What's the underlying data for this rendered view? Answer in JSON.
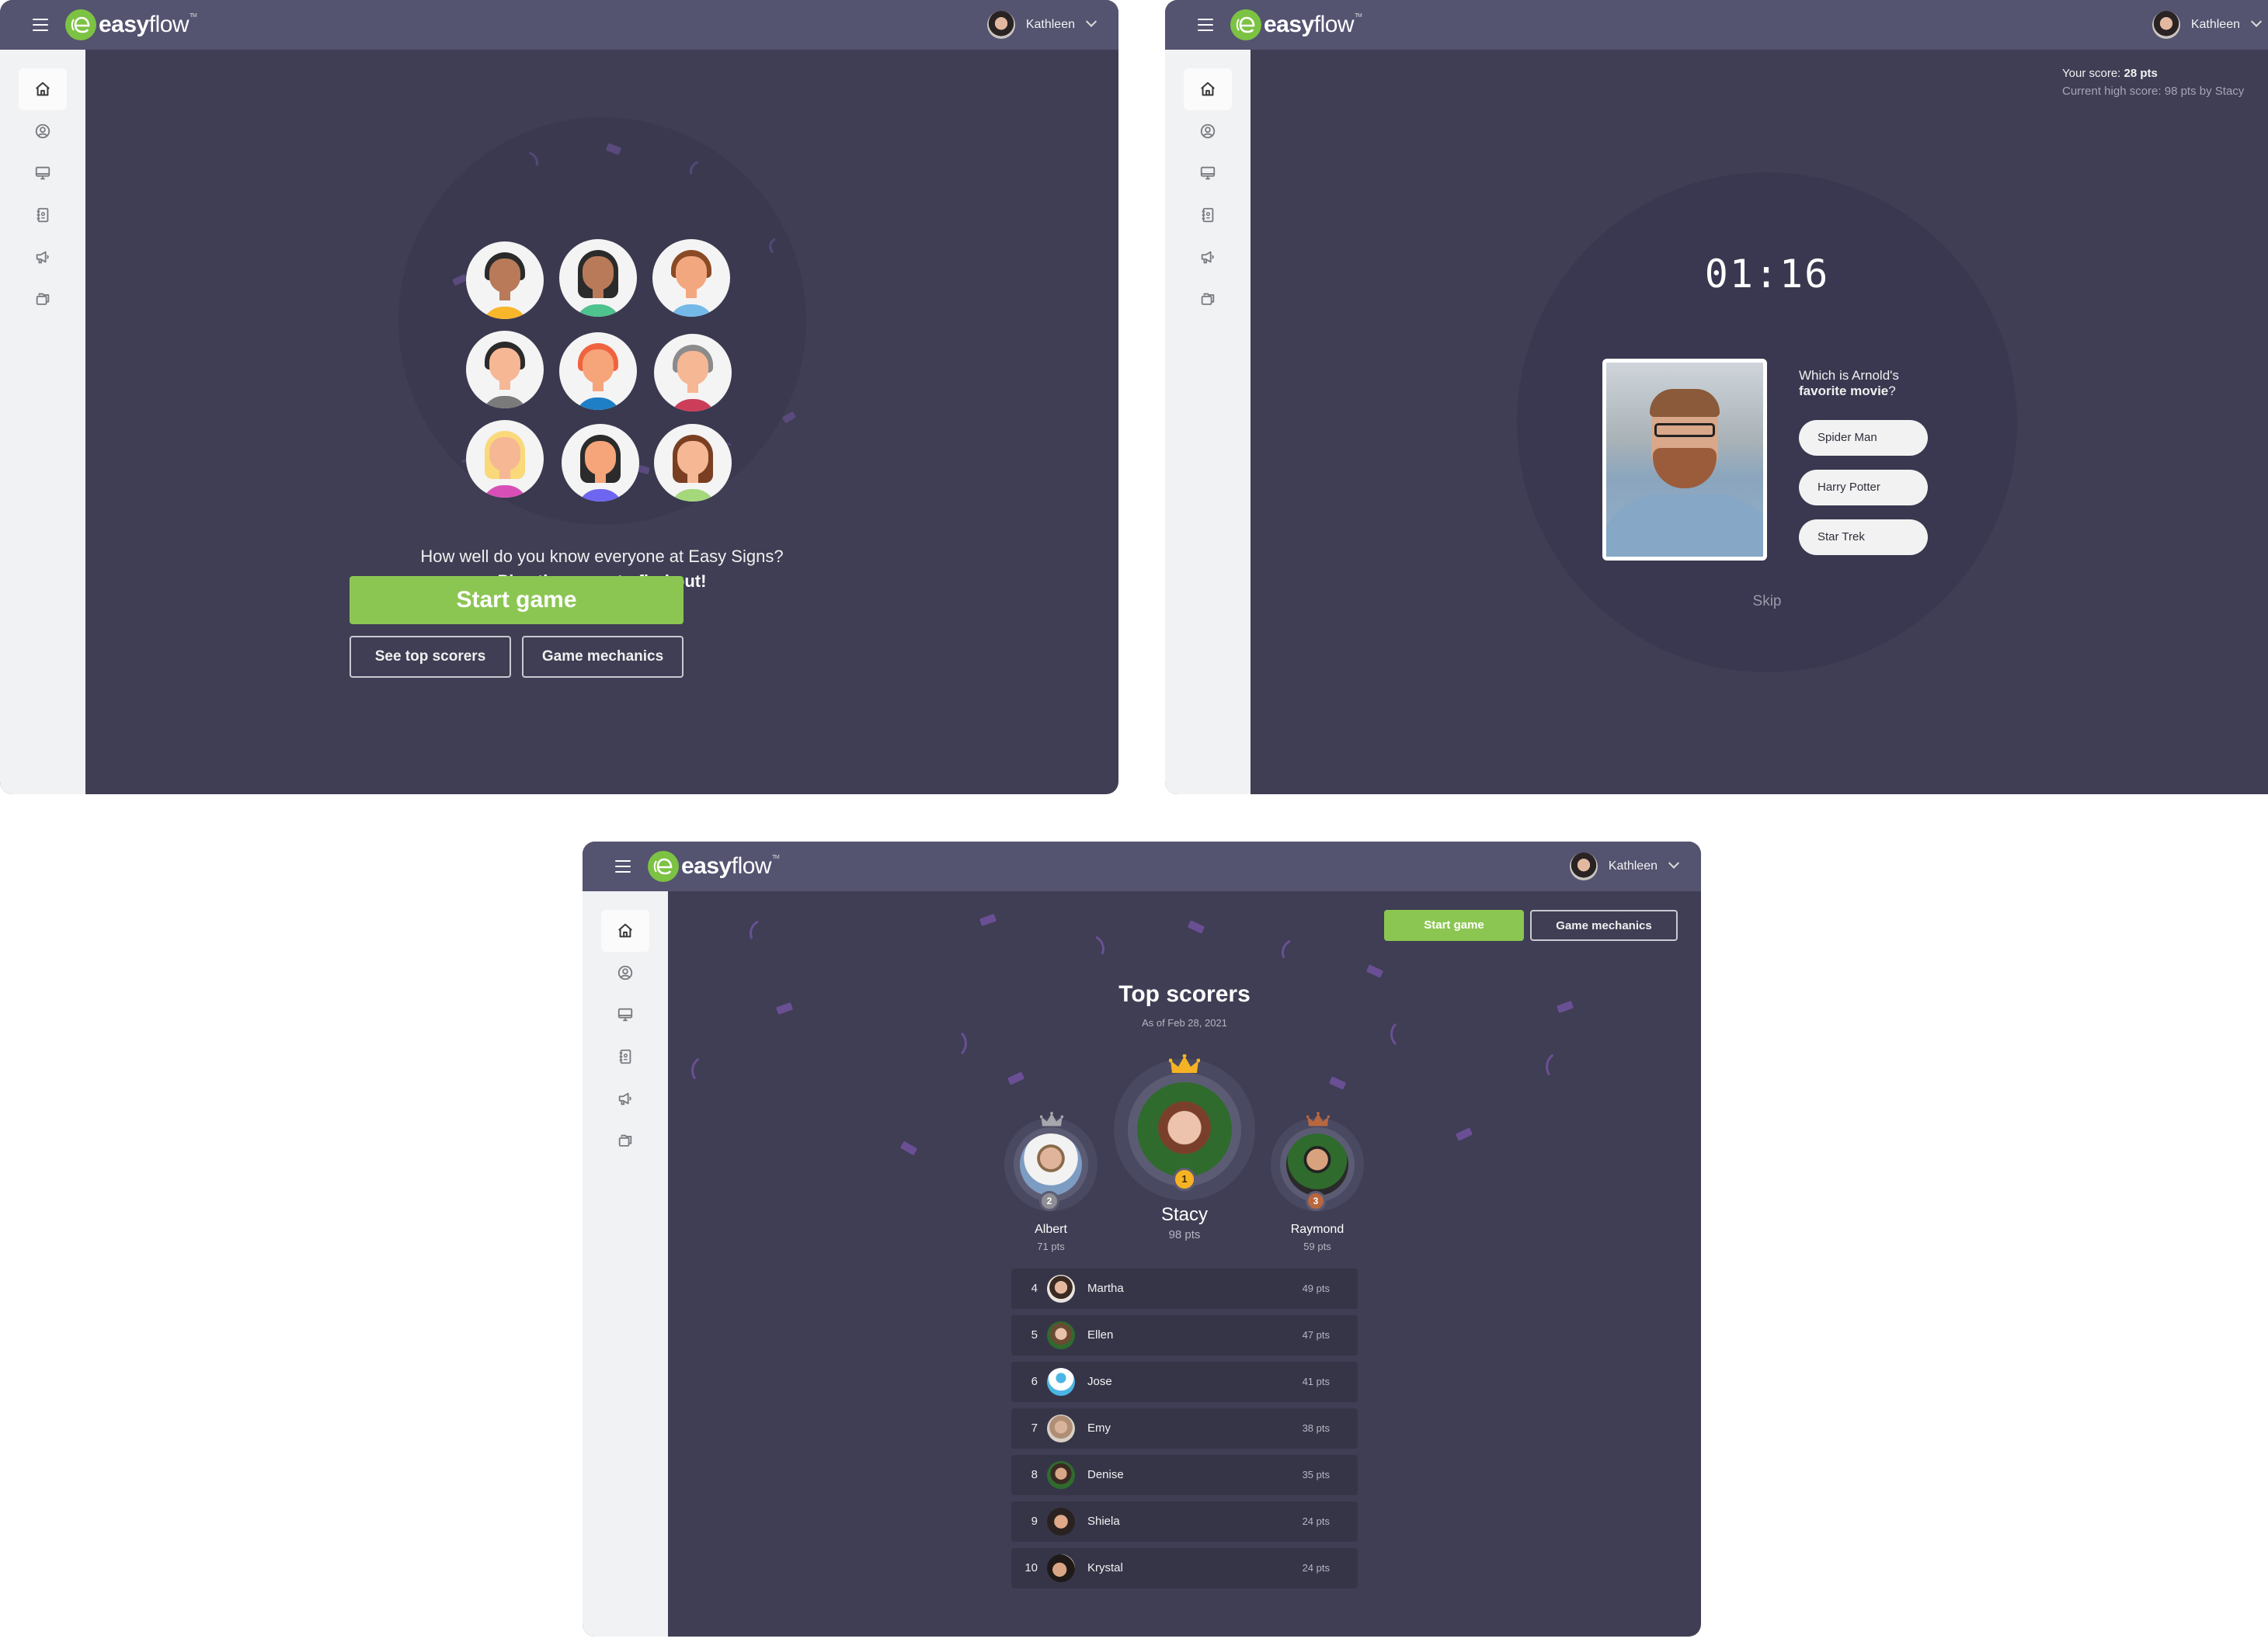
{
  "app": {
    "brand": {
      "name_bold": "easy",
      "name_light": "flow",
      "trademark": "TM"
    },
    "user": {
      "name": "Kathleen"
    },
    "sidebar": {
      "items": [
        {
          "id": "home",
          "icon": "home-icon",
          "active": true
        },
        {
          "id": "profile",
          "icon": "user-circle-icon",
          "active": false
        },
        {
          "id": "display",
          "icon": "monitor-icon",
          "active": false
        },
        {
          "id": "directory",
          "icon": "contact-book-icon",
          "active": false
        },
        {
          "id": "announcements",
          "icon": "megaphone-icon",
          "active": false
        },
        {
          "id": "files",
          "icon": "folders-icon",
          "active": false
        }
      ]
    },
    "colors": {
      "accent": "#8bc652",
      "header": "#545370",
      "background": "#3f3e54",
      "sidebar": "#f1f2f4",
      "gold": "#f5b324",
      "silver": "#9a9a9a",
      "bronze": "#b8673f"
    }
  },
  "intro_screen": {
    "line1": "How well do you know everyone at Easy Signs?",
    "line2": "Play the game to find out!",
    "start_label": "Start game",
    "scorers_label": "See top scorers",
    "mechanics_label": "Game mechanics",
    "illustration_avatars": [
      {
        "skin": "#b97a5a",
        "hair": "#2b2b2b",
        "shirt": "#f8b62a"
      },
      {
        "skin": "#b97a5a",
        "hair": "#2b2b2b",
        "shirt": "#4fc38e"
      },
      {
        "skin": "#f3a77f",
        "hair": "#8a4a25",
        "shirt": "#74b9e8"
      },
      {
        "skin": "#f6b795",
        "hair": "#2b2b2b",
        "shirt": "#7a7a7a"
      },
      {
        "skin": "#f6a47a",
        "hair": "#f0633f",
        "shirt": "#1e7fc7"
      },
      {
        "skin": "#f6b795",
        "hair": "#8b8b8b",
        "shirt": "#cc3d59"
      },
      {
        "skin": "#f6b795",
        "hair": "#f9d97a",
        "shirt": "#d74fb6"
      },
      {
        "skin": "#f6a47a",
        "hair": "#2b2b2b",
        "shirt": "#6e66f0"
      },
      {
        "skin": "#f6b795",
        "hair": "#7a3f22",
        "shirt": "#a4d87b"
      }
    ]
  },
  "game_screen": {
    "score_label": "Your score:",
    "score_value": "28 pts",
    "high_score_text": "Current high score: 98 pts by Stacy",
    "timer": "01:16",
    "question_plain": "Which is Arnold's",
    "question_bold": "favorite movie",
    "question_end": "?",
    "options": [
      "Spider Man",
      "Harry Potter",
      "Star Trek"
    ],
    "skip_label": "Skip"
  },
  "scores_screen": {
    "start_label": "Start game",
    "mechanics_label": "Game mechanics",
    "title": "Top scorers",
    "as_of": "As of Feb 28, 2021",
    "podium": [
      {
        "rank": "1",
        "name": "Stacy",
        "pts": "98 pts",
        "medal": "gold"
      },
      {
        "rank": "2",
        "name": "Albert",
        "pts": "71 pts",
        "medal": "silver"
      },
      {
        "rank": "3",
        "name": "Raymond",
        "pts": "59 pts",
        "medal": "bronze"
      }
    ],
    "list": [
      {
        "rank": "4",
        "name": "Martha",
        "pts": "49 pts"
      },
      {
        "rank": "5",
        "name": "Ellen",
        "pts": "47 pts"
      },
      {
        "rank": "6",
        "name": "Jose",
        "pts": "41 pts"
      },
      {
        "rank": "7",
        "name": "Emy",
        "pts": "38 pts"
      },
      {
        "rank": "8",
        "name": "Denise",
        "pts": "35 pts"
      },
      {
        "rank": "9",
        "name": "Shiela",
        "pts": "24 pts"
      },
      {
        "rank": "10",
        "name": "Krystal",
        "pts": "24 pts"
      }
    ]
  }
}
